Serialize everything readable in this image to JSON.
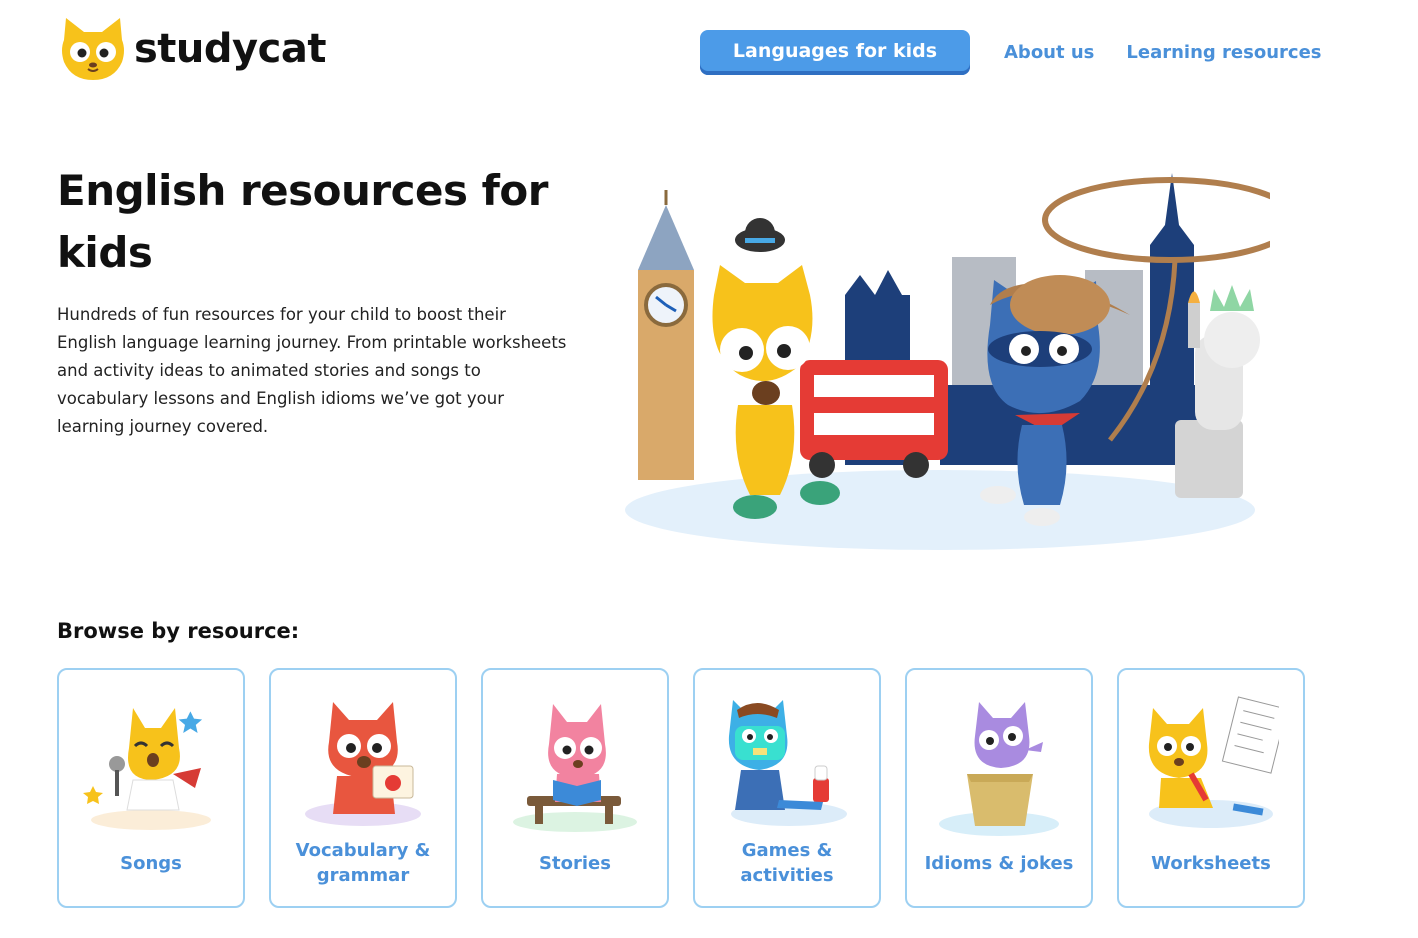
{
  "brand": {
    "name": "studycat"
  },
  "nav": {
    "cta_label": "Languages for kids",
    "about_label": "About us",
    "learning_label": "Learning resources"
  },
  "hero": {
    "title": "English resources for kids",
    "description": "Hundreds of fun resources for your child to boost their English language learning journey. From printable worksheets and activity ideas to animated stories and songs to vocabulary lessons and English idioms we’ve got your learning journey covered."
  },
  "browse": {
    "title": "Browse by resource:",
    "cards": [
      {
        "label": "Songs"
      },
      {
        "label": "Vocabulary & grammar"
      },
      {
        "label": "Stories"
      },
      {
        "label": "Games & activities"
      },
      {
        "label": "Idioms & jokes"
      },
      {
        "label": "Worksheets"
      }
    ]
  },
  "colors": {
    "accent": "#4c9be8",
    "link": "#4a90d9",
    "card_border": "#9dd0f2",
    "cat_yellow": "#f7c21b"
  }
}
